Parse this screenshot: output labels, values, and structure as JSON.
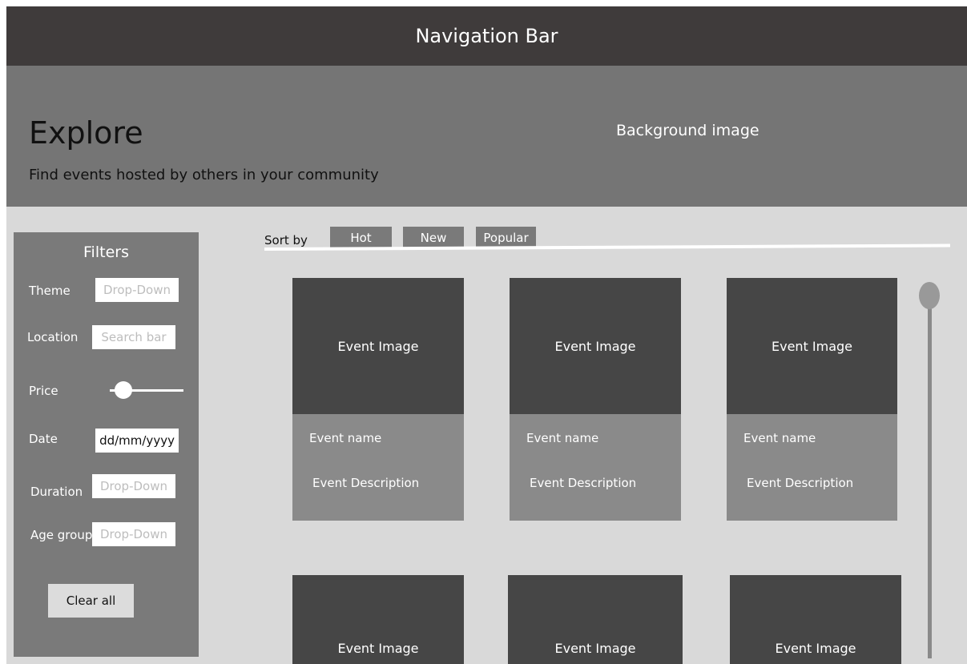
{
  "nav": {
    "title": "Navigation Bar"
  },
  "hero": {
    "title": "Explore",
    "subtitle": "Find events hosted by others in your community",
    "background_label": "Background image"
  },
  "filters": {
    "title": "Filters",
    "theme": {
      "label": "Theme",
      "placeholder": "Drop-Down"
    },
    "location": {
      "label": "Location",
      "placeholder": "Search bar"
    },
    "price": {
      "label": "Price"
    },
    "date": {
      "label": "Date",
      "value": "dd/mm/yyyy"
    },
    "duration": {
      "label": "Duration",
      "placeholder": "Drop-Down"
    },
    "age_group": {
      "label": "Age group",
      "placeholder": "Drop-Down"
    },
    "clear_label": "Clear all"
  },
  "sort": {
    "label": "Sort by",
    "options": [
      "Hot",
      "New",
      "Popular"
    ]
  },
  "events": [
    {
      "image": "Event Image",
      "name": "Event name",
      "description": "Event Description"
    },
    {
      "image": "Event Image",
      "name": "Event name",
      "description": "Event Description"
    },
    {
      "image": "Event Image",
      "name": "Event name",
      "description": "Event Description"
    },
    {
      "image": "Event Image"
    },
    {
      "image": "Event Image"
    },
    {
      "image": "Event Image"
    }
  ],
  "colors": {
    "nav": "#3f3b3b",
    "hero": "#757575",
    "content": "#d9d9d9",
    "panel": "#7a7a7a",
    "card_image": "#464646",
    "card_body": "#8a8a8a"
  }
}
